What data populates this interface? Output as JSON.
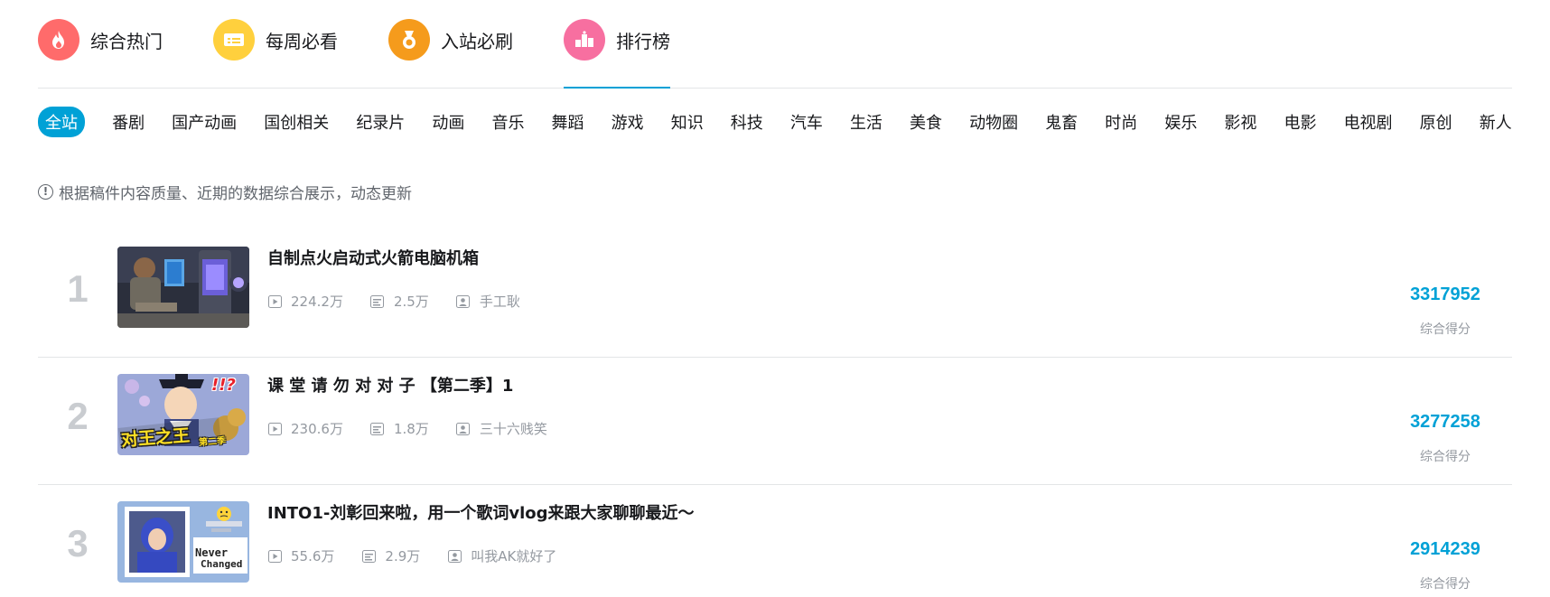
{
  "topnav": {
    "items": [
      {
        "label": "综合热门",
        "icon": "fire-icon",
        "color": "#ff6b6b"
      },
      {
        "label": "每周必看",
        "icon": "ticket-icon",
        "color": "#ffd03d"
      },
      {
        "label": "入站必刷",
        "icon": "medal-icon",
        "color": "#f59b1c"
      },
      {
        "label": "排行榜",
        "icon": "podium-icon",
        "color": "#f76fa0",
        "active": true
      }
    ]
  },
  "categories": [
    "全站",
    "番剧",
    "国产动画",
    "国创相关",
    "纪录片",
    "动画",
    "音乐",
    "舞蹈",
    "游戏",
    "知识",
    "科技",
    "汽车",
    "生活",
    "美食",
    "动物圈",
    "鬼畜",
    "时尚",
    "娱乐",
    "影视",
    "电影",
    "电视剧",
    "原创",
    "新人"
  ],
  "active_category": "全站",
  "notice": {
    "text": "根据稿件内容质量、近期的数据综合展示，动态更新"
  },
  "ranking": [
    {
      "rank": "1",
      "title": "自制点火启动式火箭电脑机箱",
      "views": "224.2万",
      "comments": "2.5万",
      "author": "手工耿",
      "score": "3317952",
      "score_label": "综合得分"
    },
    {
      "rank": "2",
      "title": "课 堂 请 勿 对 对 子 【第二季】1",
      "views": "230.6万",
      "comments": "1.8万",
      "author": "三十六贱笑",
      "score": "3277258",
      "score_label": "综合得分",
      "thumb_text": "对王之王",
      "thumb_text_small": "第二季",
      "thumb_mark": "!!?"
    },
    {
      "rank": "3",
      "title": "INTO1-刘彰回来啦，用一个歌词vlog来跟大家聊聊最近～",
      "views": "55.6万",
      "comments": "2.9万",
      "author": "叫我AK就好了",
      "score": "2914239",
      "score_label": "综合得分",
      "thumb_text": "Never",
      "thumb_text_2": "Changed"
    }
  ],
  "colors": {
    "accent": "#00a1d6",
    "rank_num": "#c9ccd0",
    "meta": "#9499a0"
  }
}
